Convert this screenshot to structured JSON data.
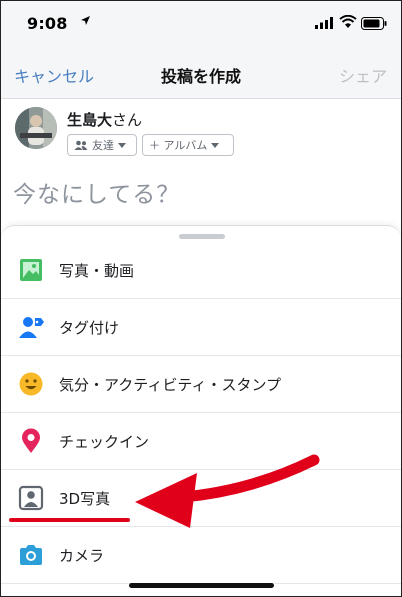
{
  "status_bar": {
    "time": "9:08"
  },
  "nav": {
    "cancel": "キャンセル",
    "title": "投稿を作成",
    "share": "シェア"
  },
  "user": {
    "name": "生島大",
    "honorific": "さん",
    "audience": "友達",
    "album": "＋ アルバム"
  },
  "composer": {
    "placeholder": "今なにしてる？"
  },
  "menu": [
    {
      "label": "写真・動画",
      "icon": "photo-video-icon"
    },
    {
      "label": "タグ付け",
      "icon": "tag-people-icon"
    },
    {
      "label": "気分・アクティビティ・スタンプ",
      "icon": "feeling-emoji-icon"
    },
    {
      "label": "チェックイン",
      "icon": "check-in-pin-icon"
    },
    {
      "label": "3D写真",
      "icon": "3d-photo-icon"
    },
    {
      "label": "カメラ",
      "icon": "camera-icon"
    }
  ],
  "colors": {
    "accent_blue": "#4a7fc1",
    "annotation_red": "#e0001a",
    "photo_green": "#45bd62",
    "pin_pink": "#e4245c",
    "emoji_yellow": "#f7b928"
  }
}
